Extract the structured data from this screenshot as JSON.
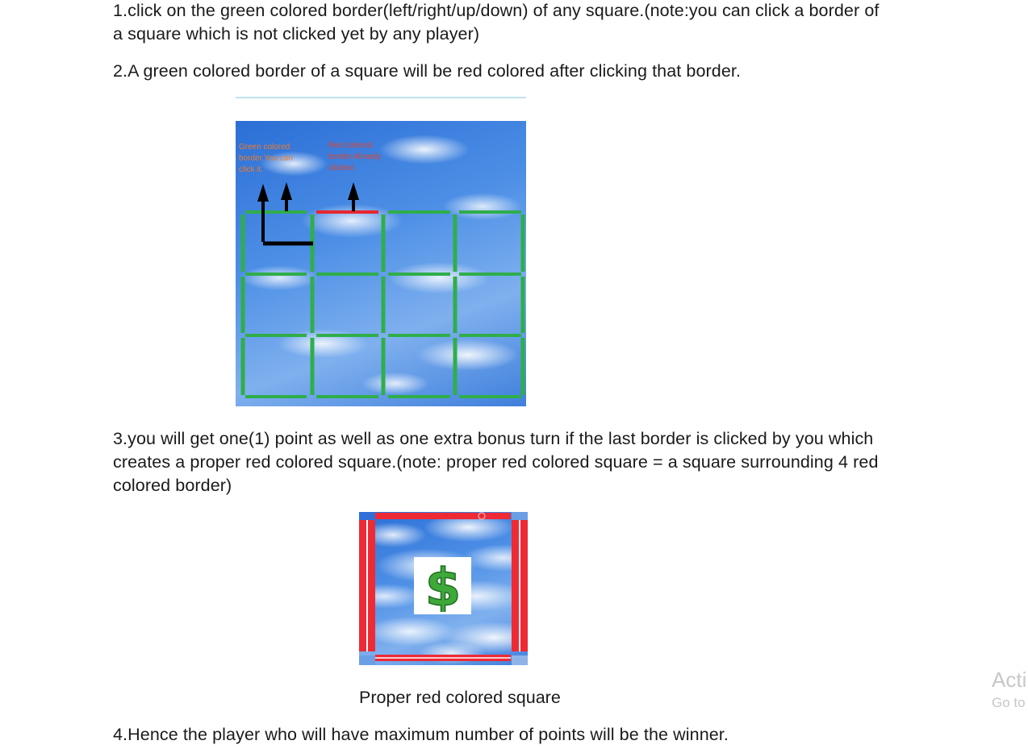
{
  "instructions": {
    "step1": "1.click on the green colored border(left/right/up/down) of any square.(note:you can click a border of a square which is not clicked yet by any player)",
    "step2": "2.A green colored border of a square will be red colored after clicking that border.",
    "step3": "3.you will get one(1) point as well as one extra bonus turn if the last border is clicked by you which creates a proper red colored square.(note: proper red colored square = a square surrounding 4 red colored border)",
    "step4": "4.Hence the player who will have maximum number of points will be the winner."
  },
  "board_image": {
    "green_note": "Green colored border.You can click it.",
    "red_note": "Red colored border.Already clicked.",
    "grid": {
      "rows": 3,
      "cols": 4,
      "clicked_border": "top of row 1, column 2"
    },
    "colors": {
      "unclicked": "#2fae4a",
      "clicked": "#e8262e",
      "arrow": "#000000"
    }
  },
  "square_image": {
    "caption": "Proper red colored square",
    "center_icon": "dollar-icon",
    "colors": {
      "border": "#ee2a35",
      "dollar": "#3fa83a"
    }
  },
  "watermark": {
    "line1": "Acti",
    "line2": "Go to"
  }
}
